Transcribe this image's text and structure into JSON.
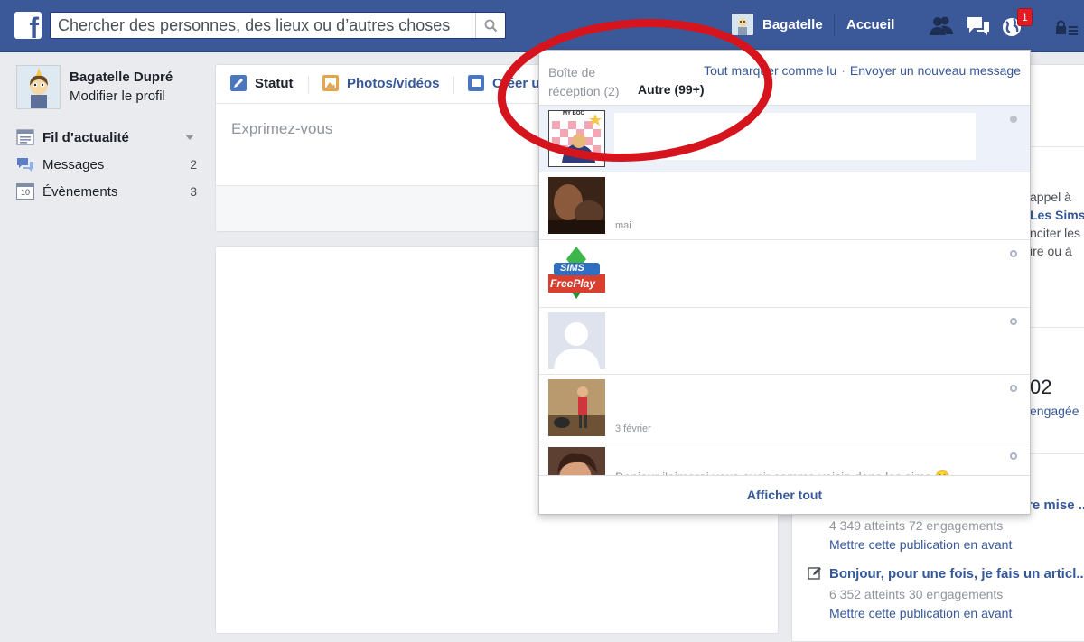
{
  "topbar": {
    "search_placeholder": "Chercher des personnes, des lieux ou d’autres choses",
    "user_name": "Bagatelle",
    "home_label": "Accueil",
    "notification_count": "1",
    "brand_color": "#3b5998"
  },
  "left_nav": {
    "profile_name": "Bagatelle Dupré",
    "edit_profile": "Modifier le profil",
    "items": [
      {
        "label": "Fil d’actualité",
        "count": ""
      },
      {
        "label": "Messages",
        "count": "2"
      },
      {
        "label": "Évènements",
        "count": "3"
      }
    ],
    "events_icon_day": "10"
  },
  "composer": {
    "tab_status": "Statut",
    "tab_photos": "Photos/vidéos",
    "tab_create": "Créer u",
    "placeholder": "Exprimez-vous"
  },
  "messages_dropdown": {
    "inbox_label": "Boîte de réception (2)",
    "other_label": "Autre (99+)",
    "mark_all_read": "Tout marquer comme lu",
    "separator": "·",
    "new_message": "Envoyer un nouveau message",
    "see_all": "Afficher tout",
    "threads": [
      {
        "thumb": "my-boo-sticker",
        "time": "",
        "preview": "",
        "unread": true
      },
      {
        "thumb": "photo-blurry",
        "time": "mai",
        "preview": "",
        "unread": false
      },
      {
        "thumb": "sims-freeplay-logo",
        "time": "",
        "preview": "",
        "unread": false
      },
      {
        "thumb": "default-avatar",
        "time": "",
        "preview": "",
        "unread": false
      },
      {
        "thumb": "sims-character",
        "time": "3 février",
        "preview": "",
        "unread": false
      },
      {
        "thumb": "photo-girl",
        "time": "",
        "preview": "Bonjour j'aimerai vous avoir comme voisin dans les sims 🙂",
        "unread": false
      }
    ],
    "sims_logo_line1": "SIMS",
    "sims_logo_line2": "FreePlay",
    "sticker_caption": "MY BOO"
  },
  "right_column": {
    "snippet_1": "appel à",
    "snippet_2": "Les Sims",
    "snippet_3": "nciter les",
    "snippet_4": "ire ou à",
    "big_number": "02",
    "snippet_5": "engagée",
    "post_1_title_tail": "re mise ...",
    "post_1_stats": "4 349 atteints 72 engagements",
    "post_1_promote": "Mettre cette publication en avant",
    "post_2_title": "Bonjour, pour une fois, je fais un articl...",
    "post_2_stats": "6 352 atteints 30 engagements",
    "post_2_promote": "Mettre cette publication en avant"
  }
}
